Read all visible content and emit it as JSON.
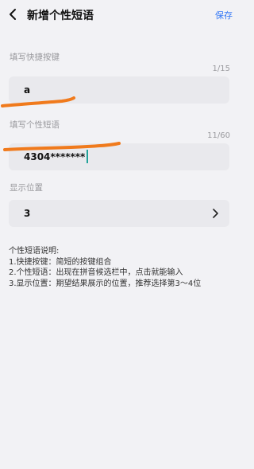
{
  "header": {
    "title": "新增个性短语",
    "save_label": "保存"
  },
  "shortcut": {
    "label": "填写快捷按键",
    "counter": "1/15",
    "value": "a"
  },
  "phrase": {
    "label": "填写个性短语",
    "counter": "11/60",
    "value": "4304*******"
  },
  "position": {
    "label": "显示位置",
    "value": "3"
  },
  "instructions": {
    "title": "个性短语说明:",
    "lines": [
      "1.快捷按键：简短的按键组合",
      "2.个性短语：出现在拼音候选栏中，点击就能输入",
      "3.显示位置：期望结果展示的位置，推荐选择第3～4位"
    ]
  },
  "colors": {
    "accent": "#3478f6",
    "scribble": "#f07a1c",
    "cursor": "#22a29a"
  }
}
